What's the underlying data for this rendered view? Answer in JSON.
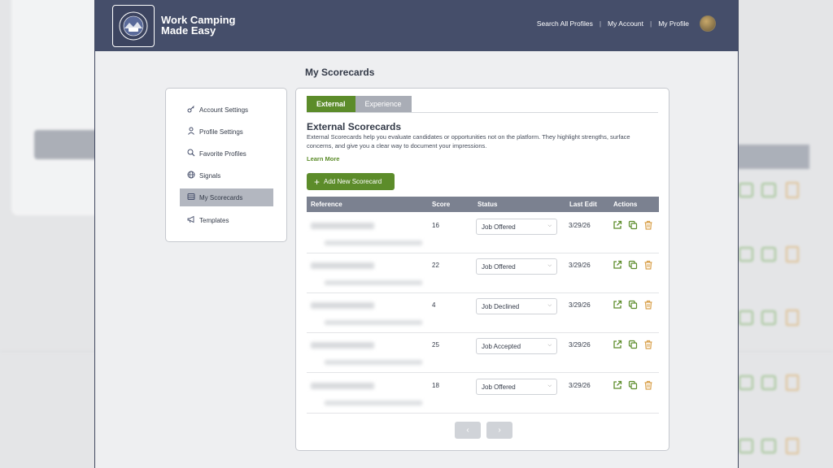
{
  "header": {
    "brand_line1": "Work Camping",
    "brand_line2": "Made Easy",
    "nav": [
      "Search All Profiles",
      "My Account",
      "My Profile"
    ]
  },
  "page_title": "My Scorecards",
  "sidebar": {
    "items": [
      {
        "label": "Account Settings",
        "icon": "key-icon"
      },
      {
        "label": "Profile Settings",
        "icon": "person-icon"
      },
      {
        "label": "Favorite Profiles",
        "icon": "search-icon"
      },
      {
        "label": "Signals",
        "icon": "globe-icon"
      },
      {
        "label": "My Scorecards",
        "icon": "card-icon",
        "active": true
      },
      {
        "label": "Templates",
        "icon": "megaphone-icon"
      }
    ]
  },
  "tabs": [
    {
      "label": "External",
      "active": true
    },
    {
      "label": "Experience",
      "active": false
    }
  ],
  "section": {
    "title": "External Scorecards",
    "description": "External Scorecards help you evaluate candidates or opportunities not on the platform. They highlight strengths, surface concerns, and give you a clear way to document your impressions.",
    "learn_more": "Learn More",
    "add_button": "Add New Scorecard"
  },
  "table": {
    "columns": [
      "Reference",
      "Score",
      "Status",
      "Last Edit",
      "Actions"
    ],
    "rows": [
      {
        "score": "16",
        "status": "Job Offered",
        "last_edit": "3/29/26"
      },
      {
        "score": "22",
        "status": "Job Offered",
        "last_edit": "3/29/26"
      },
      {
        "score": "4",
        "status": "Job Declined",
        "last_edit": "3/29/26"
      },
      {
        "score": "25",
        "status": "Job Accepted",
        "last_edit": "3/29/26"
      },
      {
        "score": "18",
        "status": "Job Offered",
        "last_edit": "3/29/26"
      }
    ]
  },
  "pager": {
    "prev": "‹",
    "next": "›"
  },
  "colors": {
    "accent": "#5c8c2a",
    "header": "#454e6a",
    "trash": "#d9a04a"
  }
}
